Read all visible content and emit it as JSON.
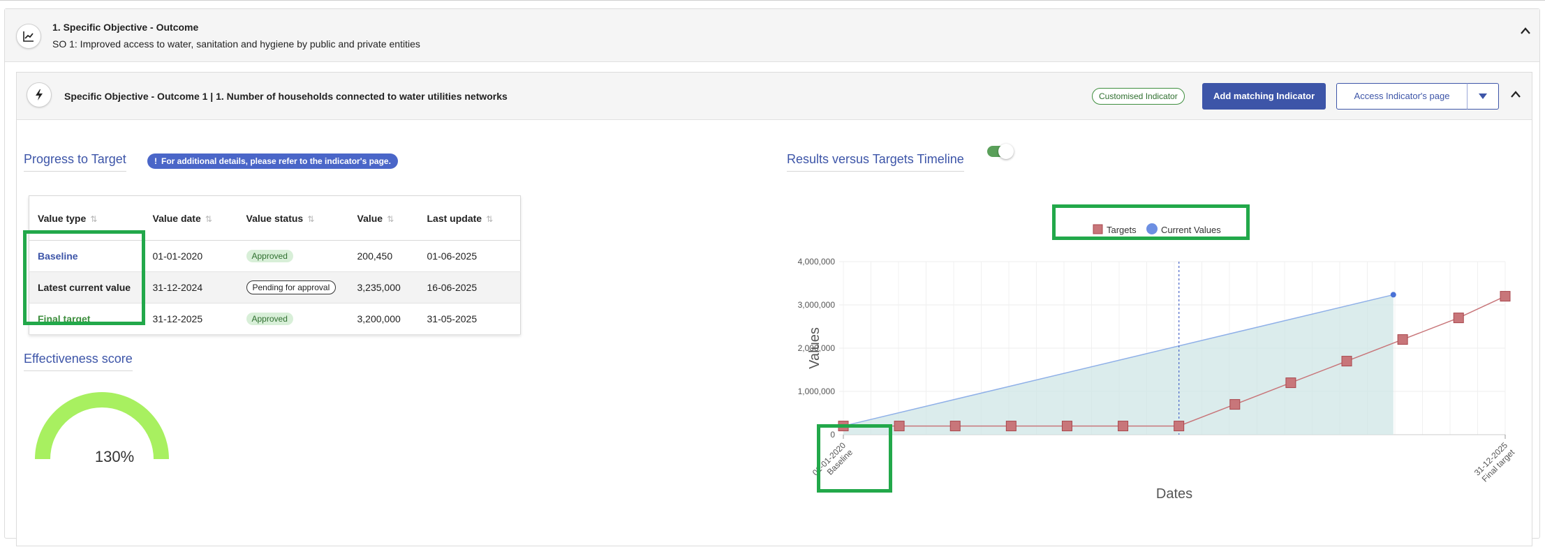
{
  "objective": {
    "title": "1. Specific Objective - Outcome",
    "subtitle": "SO 1: Improved access to water, sanitation and hygiene by public and private entities"
  },
  "indicator": {
    "title": "Specific Objective - Outcome 1 | 1. Number of households connected to water utilities networks",
    "badge": "Customised Indicator",
    "add_button": "Add matching Indicator",
    "access_button": "Access Indicator's page"
  },
  "progress": {
    "title": "Progress to Target",
    "info": "For additional details, please refer to the indicator's page.",
    "info_icon": "!",
    "columns": [
      "Value type",
      "Value date",
      "Value status",
      "Value",
      "Last update"
    ],
    "rows": [
      {
        "type": "Baseline",
        "date": "01-01-2020",
        "status": "Approved",
        "value": "200,450",
        "updated": "01-06-2025",
        "type_color": "#3d55a8",
        "status_kind": "ok"
      },
      {
        "type": "Latest current value",
        "date": "31-12-2024",
        "status": "Pending for approval",
        "value": "3,235,000",
        "updated": "16-06-2025",
        "type_color": "#222222",
        "status_kind": "pending"
      },
      {
        "type": "Final target",
        "date": "31-12-2025",
        "status": "Approved",
        "value": "3,200,000",
        "updated": "31-05-2025",
        "type_color": "#3e8e3e",
        "status_kind": "ok"
      }
    ]
  },
  "effectiveness": {
    "title": "Effectiveness score",
    "value_text": "130%",
    "score_fraction": 1.3,
    "gauge_color": "#a8f060"
  },
  "timeline": {
    "title": "Results versus Targets Timeline",
    "toggle_on": true
  },
  "colors": {
    "accent": "#3d55a8",
    "highlight": "#22a84a",
    "target_marker": "#c8767a",
    "current_line": "#8fb0e8",
    "area_fill": "#cfe6e6"
  },
  "chart_data": {
    "type": "line",
    "xlabel": "Dates",
    "ylabel": "Values",
    "ylim": [
      0,
      4000000
    ],
    "y_ticks": [
      "0",
      "1,000,000",
      "2,000,000",
      "3,000,000",
      "4,000,000"
    ],
    "x_tick_labels": [
      {
        "date": "01-01-2020",
        "label": "Baseline"
      },
      {
        "date": "31-12-2025",
        "label": "Final target"
      }
    ],
    "legend": [
      "Targets",
      "Current Values"
    ],
    "legend_position": "top",
    "grid": true,
    "series": [
      {
        "name": "Targets",
        "marker": "square",
        "points": [
          {
            "x": "2020-01",
            "y": 200450
          },
          {
            "x": "2020-07",
            "y": 200450
          },
          {
            "x": "2021-01",
            "y": 200450
          },
          {
            "x": "2021-07",
            "y": 200450
          },
          {
            "x": "2022-01",
            "y": 200450
          },
          {
            "x": "2022-07",
            "y": 200450
          },
          {
            "x": "2023-01",
            "y": 200450
          },
          {
            "x": "2023-07",
            "y": 700000
          },
          {
            "x": "2024-01",
            "y": 1200000
          },
          {
            "x": "2024-07",
            "y": 1700000
          },
          {
            "x": "2025-01",
            "y": 2200000
          },
          {
            "x": "2025-07",
            "y": 2700000
          },
          {
            "x": "2025-12",
            "y": 3200000
          }
        ]
      },
      {
        "name": "Current Values",
        "marker": "circle",
        "area": true,
        "points": [
          {
            "x": "2020-01",
            "y": 200450
          },
          {
            "x": "2024-12",
            "y": 3235000
          }
        ]
      }
    ],
    "reference_line": {
      "x": "2023-01",
      "style": "dashed"
    }
  }
}
